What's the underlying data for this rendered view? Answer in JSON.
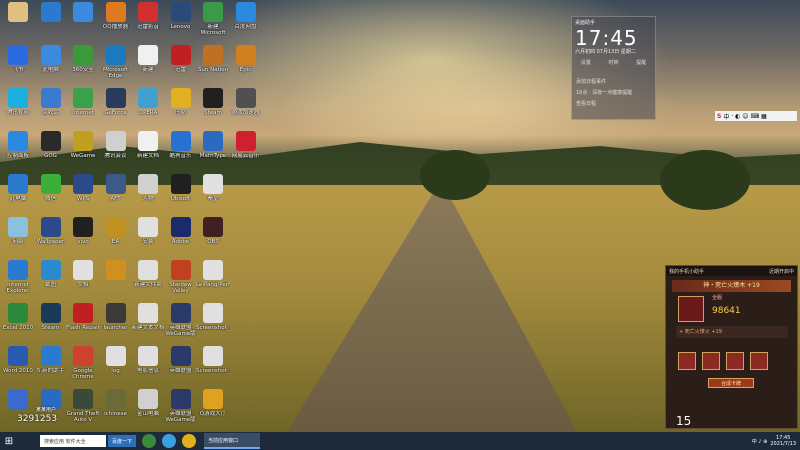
{
  "icons": [
    {
      "label": "",
      "color": "#e0c080",
      "col": 0,
      "row": 0
    },
    {
      "label": "",
      "color": "#2a7ad0",
      "col": 1,
      "row": 0
    },
    {
      "label": "",
      "color": "#3a8ae0",
      "col": 2,
      "row": 0
    },
    {
      "label": "QQ播放器",
      "color": "#e07a20",
      "col": 3,
      "row": 0
    },
    {
      "label": "迅雷影音",
      "color": "#d03030",
      "col": 4,
      "row": 0
    },
    {
      "label": "Lenovo",
      "color": "#2a4a7a",
      "col": 5,
      "row": 0
    },
    {
      "label": "新建Microsoft",
      "color": "#3a9a4a",
      "col": 6,
      "row": 0
    },
    {
      "label": "百度网盘",
      "color": "#2a8ae0",
      "col": 7,
      "row": 0
    },
    {
      "label": "飞书",
      "color": "#2a6ae0",
      "col": 0,
      "row": 1
    },
    {
      "label": "此电脑",
      "color": "#3a8ae0",
      "col": 1,
      "row": 1
    },
    {
      "label": "360安全",
      "color": "#3a9a3a",
      "col": 2,
      "row": 1
    },
    {
      "label": "Microsoft Edge",
      "color": "#1a7ac0",
      "col": 3,
      "row": 1
    },
    {
      "label": "新建",
      "color": "#f0f0f0",
      "col": 4,
      "row": 1
    },
    {
      "label": "迅雷",
      "color": "#c02020",
      "col": 5,
      "row": 1
    },
    {
      "label": "Sun Nation",
      "color": "#c07020",
      "col": 6,
      "row": 1
    },
    {
      "label": "Epic",
      "color": "#d08020",
      "col": 7,
      "row": 1
    },
    {
      "label": "腾讯视频",
      "color": "#1ab0e0",
      "col": 0,
      "row": 2
    },
    {
      "label": "回收站",
      "color": "#3a7ad0",
      "col": 1,
      "row": 2
    },
    {
      "label": "Internet",
      "color": "#3aa04a",
      "col": 2,
      "row": 2
    },
    {
      "label": "GeForce",
      "color": "#2a3a5a",
      "col": 3,
      "row": 2
    },
    {
      "label": "OPERA",
      "color": "#40a0d0",
      "col": 4,
      "row": 2
    },
    {
      "label": "压缩",
      "color": "#e0b020",
      "col": 5,
      "row": 2
    },
    {
      "label": "Steam",
      "color": "#202020",
      "col": 6,
      "row": 2
    },
    {
      "label": "游戏加速器",
      "color": "#505050",
      "col": 7,
      "row": 2
    },
    {
      "label": "控制面板",
      "color": "#2a8ae0",
      "col": 0,
      "row": 3
    },
    {
      "label": "GOG",
      "color": "#2a2a2a",
      "col": 1,
      "row": 3
    },
    {
      "label": "WeGame",
      "color": "#c0a020",
      "col": 2,
      "row": 3
    },
    {
      "label": "腾讯会议",
      "color": "#d0d0d0",
      "col": 3,
      "row": 3
    },
    {
      "label": "新建文档",
      "color": "#f0f0f0",
      "col": 4,
      "row": 3
    },
    {
      "label": "酷狗音乐",
      "color": "#2a70d0",
      "col": 5,
      "row": 3
    },
    {
      "label": "MathType",
      "color": "#2a6ac0",
      "col": 6,
      "row": 3
    },
    {
      "label": "网易云音乐",
      "color": "#d02030",
      "col": 7,
      "row": 3
    },
    {
      "label": "此电脑",
      "color": "#2a7ad0",
      "col": 0,
      "row": 4
    },
    {
      "label": "微信",
      "color": "#3ab03a",
      "col": 1,
      "row": 4
    },
    {
      "label": "WPS",
      "color": "#2a4a8a",
      "col": 2,
      "row": 4
    },
    {
      "label": "AFT",
      "color": "#3a5a8a",
      "col": 3,
      "row": 4
    },
    {
      "label": "人物",
      "color": "#d0d0d0",
      "col": 4,
      "row": 4
    },
    {
      "label": "Ubisoft",
      "color": "#202020",
      "col": 5,
      "row": 4
    },
    {
      "label": "拳皇",
      "color": "#e0e0e0",
      "col": 6,
      "row": 4
    },
    {
      "label": "网络",
      "color": "#8ac0e0",
      "col": 0,
      "row": 5
    },
    {
      "label": "Wallpaper",
      "color": "#2a4a8a",
      "col": 1,
      "row": 5
    },
    {
      "label": "vivo",
      "color": "#202020",
      "col": 2,
      "row": 5
    },
    {
      "label": "EA",
      "color": "#c09020",
      "col": 3,
      "row": 5
    },
    {
      "label": "安装",
      "color": "#e0e0e0",
      "col": 4,
      "row": 5
    },
    {
      "label": "Adobe",
      "color": "#1a2a6a",
      "col": 5,
      "row": 5
    },
    {
      "label": "OBS",
      "color": "#402020",
      "col": 6,
      "row": 5
    },
    {
      "label": "Internet Explorer",
      "color": "#2a7ad0",
      "col": 0,
      "row": 6
    },
    {
      "label": "截图",
      "color": "#2a8ad0",
      "col": 1,
      "row": 6
    },
    {
      "label": "文档",
      "color": "#e0e0e0",
      "col": 2,
      "row": 6
    },
    {
      "label": "",
      "color": "#d09020",
      "col": 3,
      "row": 6
    },
    {
      "label": "新建文件夹",
      "color": "#e0e0e0",
      "col": 4,
      "row": 6
    },
    {
      "label": "Stardew Valley",
      "color": "#c04020",
      "col": 5,
      "row": 6
    },
    {
      "label": "LeiPang/Perf",
      "color": "#e0e0e0",
      "col": 6,
      "row": 6
    },
    {
      "label": "Excel 2010",
      "color": "#2a8a3a",
      "col": 0,
      "row": 7
    },
    {
      "label": "Steam",
      "color": "#1a3a5a",
      "col": 1,
      "row": 7
    },
    {
      "label": "Flash Repair",
      "color": "#c02020",
      "col": 2,
      "row": 7
    },
    {
      "label": "launcher",
      "color": "#3a3a3a",
      "col": 3,
      "row": 7
    },
    {
      "label": "新建文本文档",
      "color": "#e0e0e0",
      "col": 4,
      "row": 7
    },
    {
      "label": "英雄联盟 WeGame版",
      "color": "#2a3a6a",
      "col": 5,
      "row": 7
    },
    {
      "label": "Screenshot_20210604",
      "color": "#e0e0e0",
      "col": 6,
      "row": 7
    },
    {
      "label": "Word 2010",
      "color": "#2a5ab0",
      "col": 0,
      "row": 8
    },
    {
      "label": "5.新的助手",
      "color": "#2a7ad0",
      "col": 1,
      "row": 8
    },
    {
      "label": "Google Chrome",
      "color": "#d04030",
      "col": 2,
      "row": 8
    },
    {
      "label": "log",
      "color": "#e0e0e0",
      "col": 3,
      "row": 8
    },
    {
      "label": "电影信息",
      "color": "#e0e0e0",
      "col": 4,
      "row": 8
    },
    {
      "label": "英雄联盟",
      "color": "#2a3a6a",
      "col": 5,
      "row": 8
    },
    {
      "label": "Screenshot_20210604",
      "color": "#e0e0e0",
      "col": 6,
      "row": 8
    },
    {
      "label": "",
      "color": "#3a6ad0",
      "col": 0,
      "row": 9
    },
    {
      "label": "",
      "color": "#2a6ac0",
      "col": 1,
      "row": 9
    },
    {
      "label": "Grand Theft Auto V",
      "color": "#3a4a3a",
      "col": 2,
      "row": 9
    },
    {
      "label": "ichinese",
      "color": "#6a6a3a",
      "col": 3,
      "row": 9
    },
    {
      "label": "金山电脑",
      "color": "#d0d0d0",
      "col": 4,
      "row": 9
    },
    {
      "label": "英雄联盟 WeGame版",
      "color": "#2a3a6a",
      "col": 5,
      "row": 9
    },
    {
      "label": "Q游戏大厅",
      "color": "#e0a020",
      "col": 6,
      "row": 9
    }
  ],
  "clock_widget": {
    "header": "桌面助手",
    "time": "17:45",
    "date": "六月初四  07月13日  星期二",
    "row1": [
      "设置",
      "时钟",
      "提醒"
    ],
    "line1": "添加日程事件",
    "line2": "16点 · 深夜一点健康提醒",
    "line3": "查看日程"
  },
  "ime_bar": {
    "label": "中"
  },
  "game_panel": {
    "header_left": "我的手机小助手",
    "header_right": "近期开启中",
    "title": "神・死亡火燎木 +19",
    "rank": "全服",
    "number": "98641",
    "enhance": "+ 死亡火燎火 +19",
    "button": "合成卡牌",
    "count": "15"
  },
  "overlay": {
    "id_text": "3291253",
    "small_text": "某某用户"
  },
  "taskbar": {
    "search": "搜索应用  软件大全",
    "btn": "百度一下",
    "active": "当前应用窗口",
    "time": "17:45",
    "date": "2021/7/13",
    "tray": "中 ♪ ⊕"
  }
}
